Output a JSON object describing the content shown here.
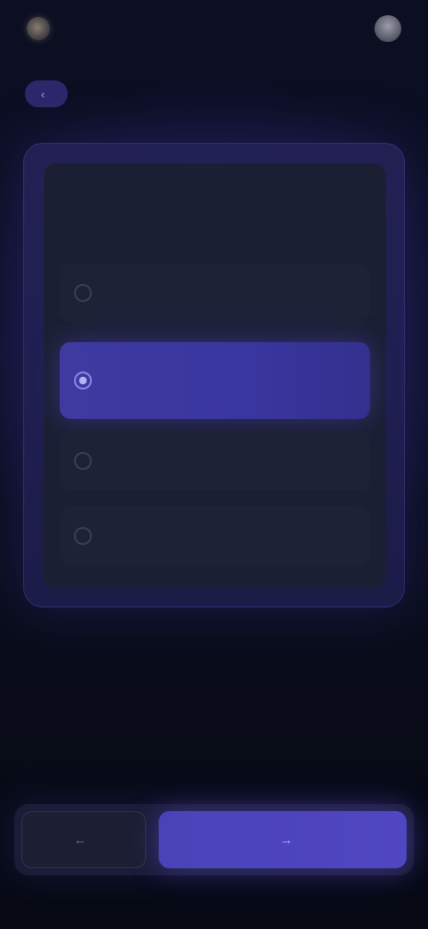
{
  "header": {
    "brand_name": "",
    "top_link": "",
    "icons": {
      "logo": "logo-mark",
      "avatar": "user-avatar"
    }
  },
  "nav": {
    "back_label": "",
    "back_icon": "chevron-left-icon"
  },
  "card": {
    "title": "",
    "options": [
      {
        "label": "",
        "sublabel": "",
        "selected": false
      },
      {
        "label": "",
        "sublabel": "",
        "selected": true
      },
      {
        "label": "",
        "sublabel": "",
        "selected": false
      },
      {
        "label": "",
        "sublabel": "",
        "selected": false
      }
    ]
  },
  "footer": {
    "back_button_label": "",
    "continue_button_label": ""
  },
  "colors": {
    "background": "#0a0d1a",
    "card_border": "#4a42a8",
    "accent": "#4a43b8",
    "selected_option": "#3f3aa0"
  }
}
